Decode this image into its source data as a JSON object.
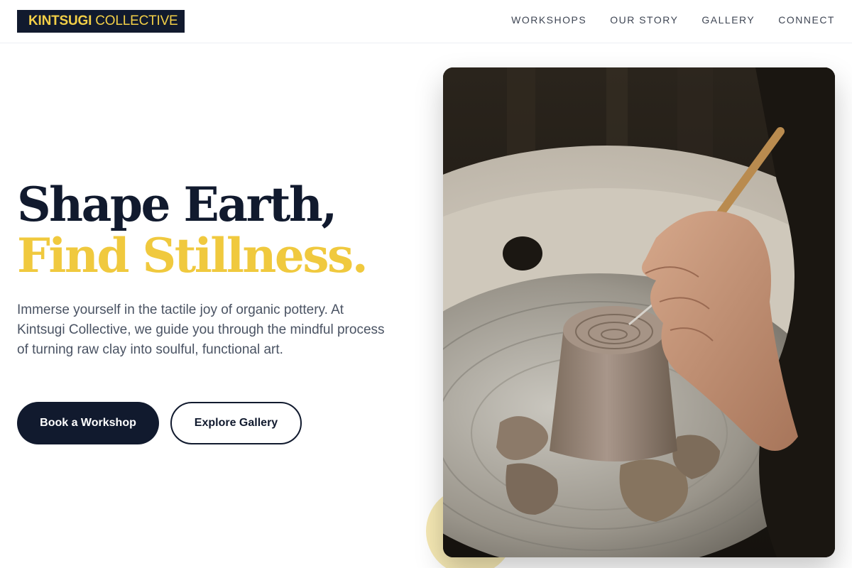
{
  "brand": {
    "name_bold": "KINTSUGI",
    "name_light": " COLLECTIVE"
  },
  "nav": {
    "items": [
      {
        "label": "WORKSHOPS"
      },
      {
        "label": "OUR STORY"
      },
      {
        "label": "GALLERY"
      },
      {
        "label": "CONNECT"
      }
    ]
  },
  "hero": {
    "headline_line1": "Shape Earth,",
    "headline_line2": "Find Stillness.",
    "description": "Immerse yourself in the tactile joy of organic pottery. At Kintsugi Collective, we guide you through the mindful process of turning raw clay into soulful, functional art.",
    "primary_button": "Book a Workshop",
    "secondary_button": "Explore Gallery",
    "image_description": "pottery-wheel-photo"
  },
  "colors": {
    "navy": "#111a2e",
    "gold": "#f0c93e",
    "text_muted": "#4a5363"
  }
}
